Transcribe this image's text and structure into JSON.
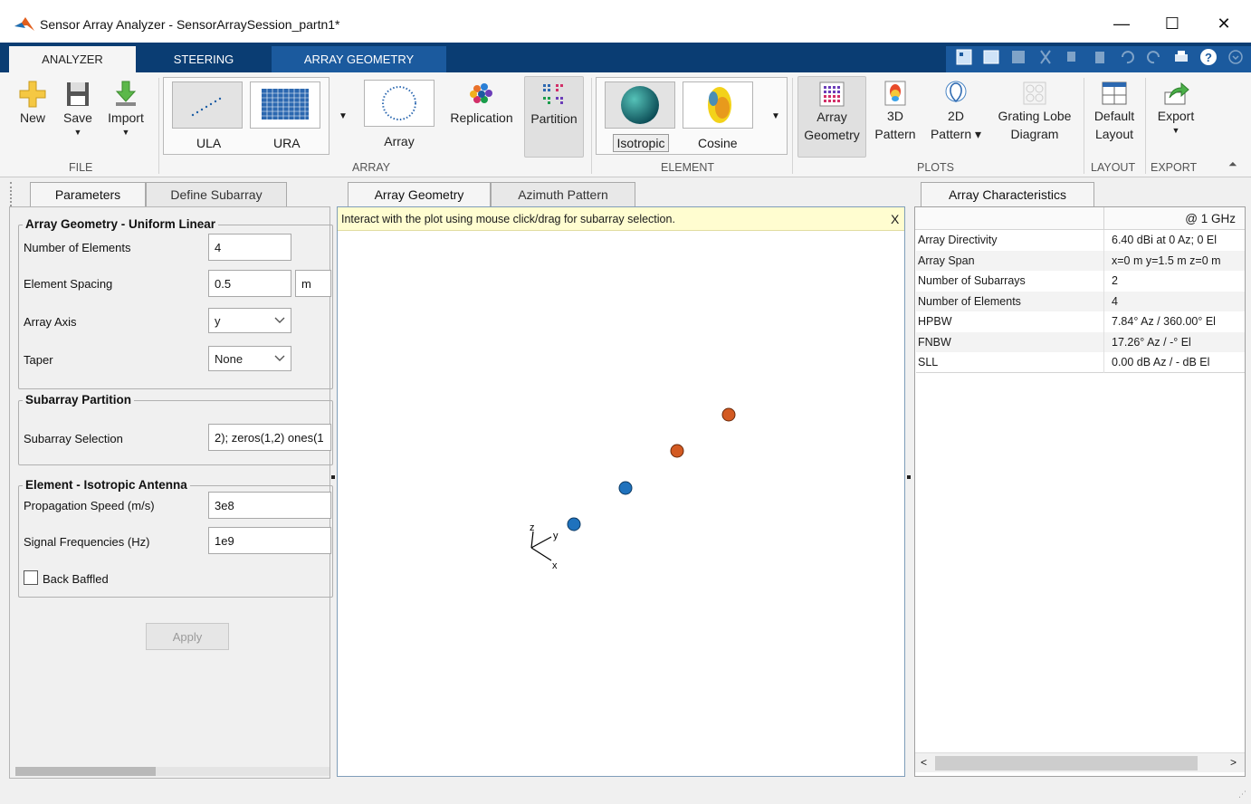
{
  "window": {
    "title": "Sensor Array Analyzer - SensorArraySession_partn1*",
    "minimize": "—",
    "maximize": "☐",
    "close": "✕"
  },
  "tabs": [
    "ANALYZER",
    "STEERING",
    "ARRAY GEOMETRY"
  ],
  "ribbon": {
    "file": {
      "label": "FILE",
      "new": "New",
      "save": "Save",
      "import": "Import"
    },
    "array": {
      "label": "ARRAY",
      "ula": "ULA",
      "ura": "URA",
      "array": "Array",
      "replication": "Replication",
      "partition": "Partition"
    },
    "element": {
      "label": "ELEMENT",
      "isotropic": "Isotropic",
      "cosine": "Cosine"
    },
    "plots": {
      "label": "PLOTS",
      "array_geometry_1": "Array",
      "array_geometry_2": "Geometry",
      "pattern3d_1": "3D",
      "pattern3d_2": "Pattern",
      "pattern2d_1": "2D",
      "pattern2d_2": "Pattern",
      "grating_1": "Grating Lobe",
      "grating_2": "Diagram"
    },
    "layout": {
      "label": "LAYOUT",
      "default_1": "Default",
      "default_2": "Layout"
    },
    "export": {
      "label": "EXPORT",
      "export": "Export"
    }
  },
  "left_panel": {
    "tabs": [
      "Parameters",
      "Define Subarray"
    ],
    "geometry_group": "Array Geometry - Uniform Linear",
    "num_elements_label": "Number of Elements",
    "num_elements_value": "4",
    "spacing_label": "Element Spacing",
    "spacing_value": "0.5",
    "spacing_unit": "m",
    "axis_label": "Array Axis",
    "axis_value": "y",
    "taper_label": "Taper",
    "taper_value": "None",
    "partition_group": "Subarray Partition",
    "selection_label": "Subarray Selection",
    "selection_value": "2); zeros(1,2) ones(1",
    "element_group": "Element - Isotropic Antenna",
    "speed_label": "Propagation Speed (m/s)",
    "speed_value": "3e8",
    "freq_label": "Signal Frequencies (Hz)",
    "freq_value": "1e9",
    "baffled_label": "Back Baffled",
    "apply": "Apply"
  },
  "center_panel": {
    "tabs": [
      "Array Geometry",
      "Azimuth Pattern"
    ],
    "info": "Interact with the plot using mouse click/drag for subarray selection.",
    "close": "X",
    "axis_z": "z",
    "axis_y": "y",
    "axis_x": "x",
    "colors": {
      "subarray1": "#1f72bd",
      "subarray2": "#d35a22"
    }
  },
  "right_panel": {
    "tab": "Array Characteristics",
    "freq_header": "@ 1 GHz",
    "rows": [
      {
        "k": "Array Directivity",
        "v": "6.40 dBi at 0 Az; 0 El"
      },
      {
        "k": "Array Span",
        "v": "x=0 m y=1.5 m z=0 m"
      },
      {
        "k": "Number of Subarrays",
        "v": "2"
      },
      {
        "k": "Number of Elements",
        "v": "4"
      },
      {
        "k": "HPBW",
        "v": "7.84° Az / 360.00° El"
      },
      {
        "k": "FNBW",
        "v": "17.26° Az / -° El"
      },
      {
        "k": "SLL",
        "v": "0.00 dB Az / - dB El"
      }
    ]
  }
}
